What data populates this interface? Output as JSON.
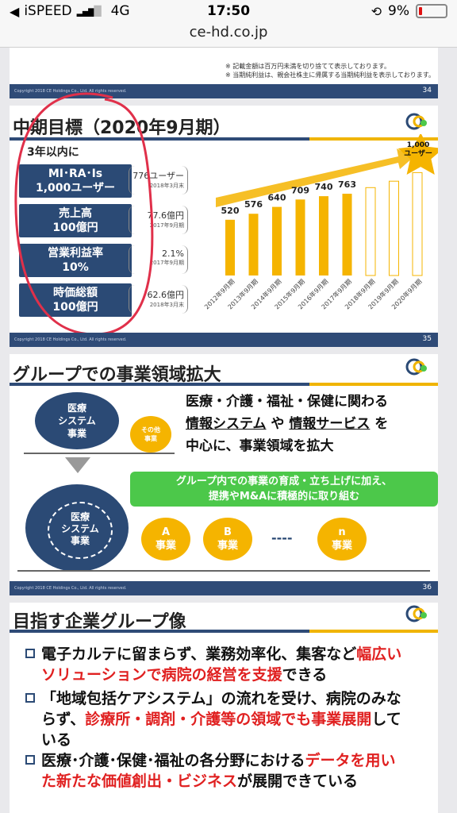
{
  "status_bar": {
    "carrier": "iSPEED",
    "network": "4G",
    "time": "17:50",
    "battery": "9%"
  },
  "browser": {
    "url": "ce-hd.co.jp"
  },
  "slide34": {
    "notes": [
      "※ 記載金額は百万円未満を切り捨てて表示しております。",
      "※ 当期純利益は、親会社株主に帰属する当期純利益を表示しております。"
    ],
    "copyright": "Copyright 2018 CE Holdings Co., Ltd. All rights reserved.",
    "page": "34"
  },
  "slide35": {
    "title": "中期目標（2020年9月期）",
    "subtitle": "3年以内に",
    "goals": [
      {
        "line1": "MI･RA･Is",
        "line2": "1,000ユーザー",
        "value": "776ユーザー",
        "date": "2018年3月末"
      },
      {
        "line1": "売上高",
        "line2": "100億円",
        "value": "77.6億円",
        "date": "2017年9月期"
      },
      {
        "line1": "営業利益率",
        "line2": "10%",
        "value": "2.1%",
        "date": "2017年9月期"
      },
      {
        "line1": "時価総額",
        "line2": "100億円",
        "value": "62.6億円",
        "date": "2018年3月末"
      }
    ],
    "star_label_1": "1,000",
    "star_label_2": "ユーザー",
    "copyright": "Copyright 2018 CE Holdings Co., Ltd. All rights reserved.",
    "page": "35"
  },
  "chart_data": {
    "type": "bar",
    "categories": [
      "2012年9月期",
      "2013年9月期",
      "2014年9月期",
      "2015年9月期",
      "2016年9月期",
      "2017年9月期",
      "2018年9月期",
      "2019年9月期",
      "2020年9月期"
    ],
    "values": [
      520,
      576,
      640,
      709,
      740,
      763,
      null,
      null,
      null
    ],
    "labels": [
      "520",
      "576",
      "640",
      "709",
      "740",
      "763",
      "",
      "",
      ""
    ],
    "color": "#f5b400",
    "ylim": [
      0,
      1000
    ]
  },
  "slide36": {
    "title": "グループでの事業領域拡大",
    "circle_main": "医療\nシステム\n事業",
    "circle_other": "その他\n事業",
    "headline_1": "医療・介護・福祉・保健に関わる",
    "headline_2a": "情報システム",
    "headline_2b": " や ",
    "headline_2c": "情報サービス",
    "headline_2d": " を",
    "headline_3": "中心に、事業領域を拡大",
    "green_1": "グループ内での事業の育成・立ち上げに加え、",
    "green_2": "提携やM&Aに積極的に取り組む",
    "inner_circle": "医療\nシステム\n事業",
    "biz_a": "A\n事業",
    "biz_b": "B\n事業",
    "biz_dash": "----",
    "biz_n": "n\n事業",
    "copyright": "Copyright 2018 CE Holdings Co., Ltd. All rights reserved.",
    "page": "36"
  },
  "slide37": {
    "title": "目指す企業グループ像",
    "b1_a": "電子カルテに留まらず、業務効率化、集客など",
    "b1_b": "幅広い",
    "b1_c": "ソリューションで病院の経営を支援",
    "b1_d": "できる",
    "b2_a": "「地域包括ケアシステム」の流れを受け、病院のみな",
    "b2_b": "らず、",
    "b2_c": "診療所・調剤・介護等の領域でも事業展開",
    "b2_d": "して",
    "b2_e": "いる",
    "b3_a": "医療･介護･保健･福祉の各分野における",
    "b3_b": "データを用い",
    "b3_c": "た新たな価値創出・ビジネス",
    "b3_d": "が展開できている"
  },
  "colors": {
    "navy": "#2b4a75",
    "orange": "#f5b400",
    "green": "#4cc84a",
    "red": "#e02020",
    "annotation": "#e0304a"
  }
}
